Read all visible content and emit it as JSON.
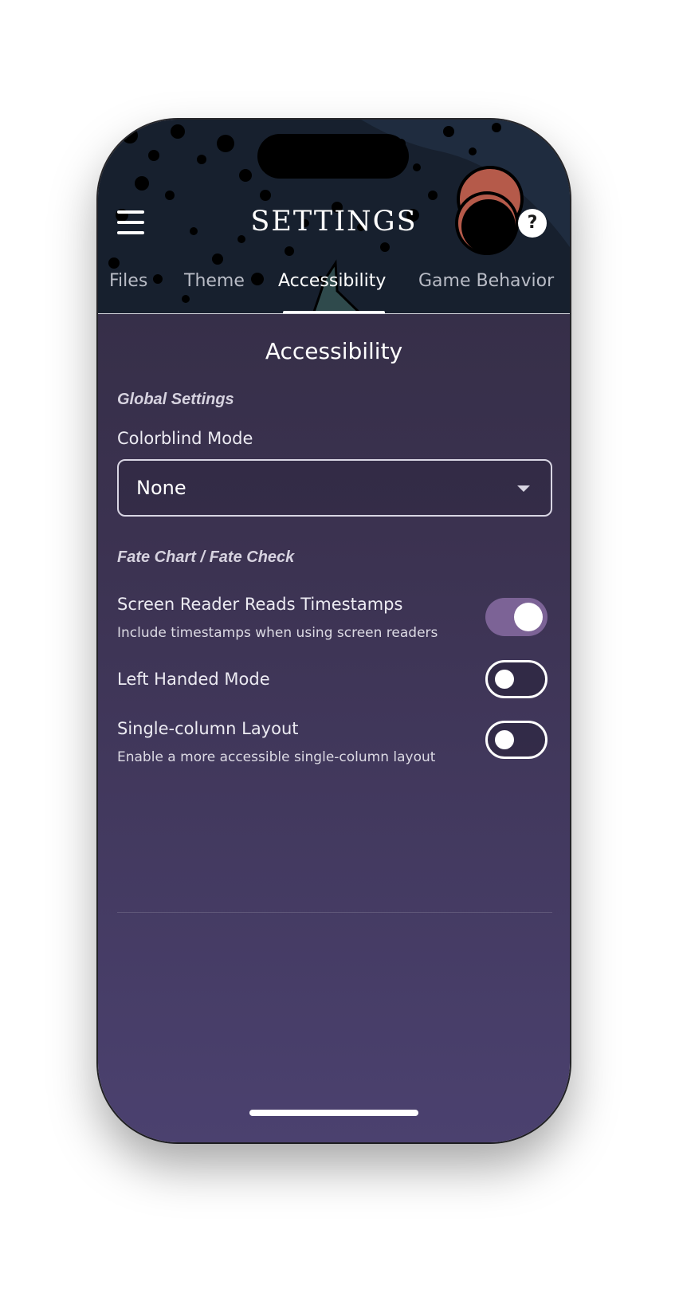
{
  "header": {
    "title": "SETTINGS",
    "menu_icon": "hamburger-menu-icon",
    "help_icon": "question-mark-icon",
    "help_glyph": "?"
  },
  "tabs": [
    {
      "label": "Files",
      "active": false
    },
    {
      "label": "Theme",
      "active": false
    },
    {
      "label": "Accessibility",
      "active": true
    },
    {
      "label": "Game Behavior",
      "active": false
    }
  ],
  "content": {
    "section_title": "Accessibility",
    "global_heading": "Global Settings",
    "colorblind": {
      "label": "Colorblind Mode",
      "selected": "None"
    },
    "fate_heading": "Fate Chart / Fate Check",
    "toggles": [
      {
        "label": "Screen Reader Reads Timestamps",
        "description": "Include timestamps when using screen readers",
        "on": true
      },
      {
        "label": "Left Handed Mode",
        "description": "",
        "on": false
      },
      {
        "label": "Single-column Layout",
        "description": "Enable a more accessible single-column layout",
        "on": false
      }
    ]
  },
  "colors": {
    "accent": "#7c6396",
    "header_bg": "#17202e",
    "content_top": "#322c42",
    "content_bottom": "#4b416f"
  }
}
